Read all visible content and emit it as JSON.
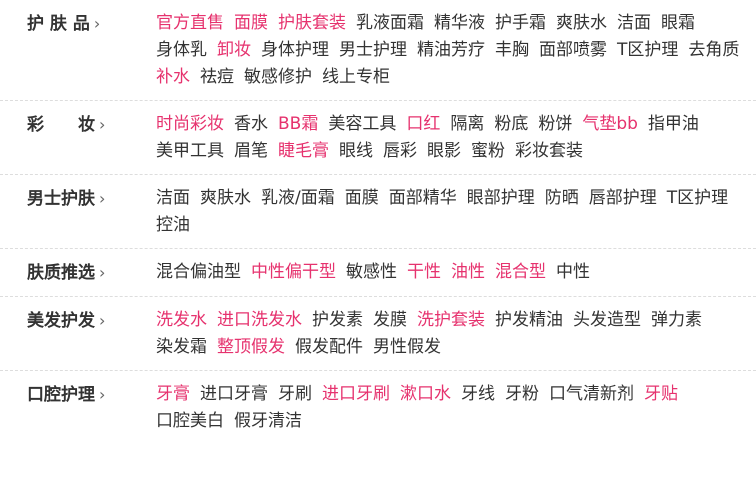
{
  "categories": [
    {
      "name": "护 肤 品",
      "links": [
        {
          "text": "官方直售",
          "hot": true
        },
        {
          "text": "面膜",
          "hot": true
        },
        {
          "text": "护肤套装",
          "hot": true
        },
        {
          "text": "乳液面霜",
          "hot": false
        },
        {
          "text": "精华液",
          "hot": false
        },
        {
          "text": "护手霜",
          "hot": false
        },
        {
          "text": "爽肤水",
          "hot": false
        },
        {
          "text": "洁面",
          "hot": false
        },
        {
          "text": "眼霜",
          "hot": false
        },
        {
          "text": "身体乳",
          "hot": false
        },
        {
          "text": "卸妆",
          "hot": true
        },
        {
          "text": "身体护理",
          "hot": false
        },
        {
          "text": "男士护理",
          "hot": false
        },
        {
          "text": "精油芳疗",
          "hot": false
        },
        {
          "text": "丰胸",
          "hot": false
        },
        {
          "text": "面部喷雾",
          "hot": false
        },
        {
          "text": "T区护理",
          "hot": false
        },
        {
          "text": "去角质",
          "hot": false
        },
        {
          "text": "补水",
          "hot": true
        },
        {
          "text": "祛痘",
          "hot": false
        },
        {
          "text": "敏感修护",
          "hot": false
        },
        {
          "text": "线上专柜",
          "hot": false
        }
      ]
    },
    {
      "name": "彩　　妆",
      "links": [
        {
          "text": "时尚彩妆",
          "hot": true
        },
        {
          "text": "香水",
          "hot": false
        },
        {
          "text": "BB霜",
          "hot": true
        },
        {
          "text": "美容工具",
          "hot": false
        },
        {
          "text": "口红",
          "hot": true
        },
        {
          "text": "隔离",
          "hot": false
        },
        {
          "text": "粉底",
          "hot": false
        },
        {
          "text": "粉饼",
          "hot": false
        },
        {
          "text": "气垫bb",
          "hot": true
        },
        {
          "text": "指甲油",
          "hot": false
        },
        {
          "text": "美甲工具",
          "hot": false
        },
        {
          "text": "眉笔",
          "hot": false
        },
        {
          "text": "睫毛膏",
          "hot": true
        },
        {
          "text": "眼线",
          "hot": false
        },
        {
          "text": "唇彩",
          "hot": false
        },
        {
          "text": "眼影",
          "hot": false
        },
        {
          "text": "蜜粉",
          "hot": false
        },
        {
          "text": "彩妆套装",
          "hot": false
        }
      ]
    },
    {
      "name": "男士护肤",
      "links": [
        {
          "text": "洁面",
          "hot": false
        },
        {
          "text": "爽肤水",
          "hot": false
        },
        {
          "text": "乳液/面霜",
          "hot": false
        },
        {
          "text": "面膜",
          "hot": false
        },
        {
          "text": "面部精华",
          "hot": false
        },
        {
          "text": "眼部护理",
          "hot": false
        },
        {
          "text": "防晒",
          "hot": false
        },
        {
          "text": "唇部护理",
          "hot": false
        },
        {
          "text": "T区护理",
          "hot": false
        },
        {
          "text": "控油",
          "hot": false
        }
      ]
    },
    {
      "name": "肤质推选",
      "links": [
        {
          "text": "混合偏油型",
          "hot": false
        },
        {
          "text": "中性偏干型",
          "hot": true
        },
        {
          "text": "敏感性",
          "hot": false
        },
        {
          "text": "干性",
          "hot": true
        },
        {
          "text": "油性",
          "hot": true
        },
        {
          "text": "混合型",
          "hot": true
        },
        {
          "text": "中性",
          "hot": false
        }
      ]
    },
    {
      "name": "美发护发",
      "links": [
        {
          "text": "洗发水",
          "hot": true
        },
        {
          "text": "进口洗发水",
          "hot": true
        },
        {
          "text": "护发素",
          "hot": false
        },
        {
          "text": "发膜",
          "hot": false
        },
        {
          "text": "洗护套装",
          "hot": true
        },
        {
          "text": "护发精油",
          "hot": false
        },
        {
          "text": "头发造型",
          "hot": false
        },
        {
          "text": "弹力素",
          "hot": false
        },
        {
          "text": "染发霜",
          "hot": false
        },
        {
          "text": "整顶假发",
          "hot": true
        },
        {
          "text": "假发配件",
          "hot": false
        },
        {
          "text": "男性假发",
          "hot": false
        }
      ]
    },
    {
      "name": "口腔护理",
      "links": [
        {
          "text": "牙膏",
          "hot": true
        },
        {
          "text": "进口牙膏",
          "hot": false
        },
        {
          "text": "牙刷",
          "hot": false
        },
        {
          "text": "进口牙刷",
          "hot": true
        },
        {
          "text": "漱口水",
          "hot": true
        },
        {
          "text": "牙线",
          "hot": false
        },
        {
          "text": "牙粉",
          "hot": false
        },
        {
          "text": "口气清新剂",
          "hot": false
        },
        {
          "text": "牙贴",
          "hot": true
        },
        {
          "text": "口腔美白",
          "hot": false
        },
        {
          "text": "假牙清洁",
          "hot": false
        }
      ]
    }
  ],
  "chevron": "›",
  "colors": {
    "hot": "#e6326e",
    "normal": "#333333",
    "divider": "#dddddd"
  }
}
